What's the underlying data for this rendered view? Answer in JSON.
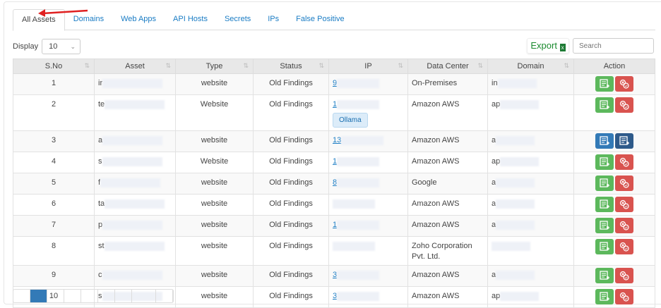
{
  "tabs": [
    "All Assets",
    "Domains",
    "Web Apps",
    "API Hosts",
    "Secrets",
    "IPs",
    "False Positive"
  ],
  "display_label": "Display",
  "display_value": "10",
  "export_label": "Export",
  "search_placeholder": "Search",
  "columns": [
    "S.No",
    "Asset",
    "Type",
    "Status",
    "IP",
    "Data Center",
    "Domain",
    "Action"
  ],
  "rows": [
    {
      "sno": "1",
      "asset": "ir",
      "type": "website",
      "status": "Old Findings",
      "ip": "9",
      "dc": "On-Premises",
      "domain": "in",
      "actions": "edit"
    },
    {
      "sno": "2",
      "asset": "te",
      "type": "Website",
      "status": "Old Findings",
      "ip": "1",
      "dc": "Amazon AWS",
      "domain": "ap",
      "badge": "Ollama",
      "actions": "edit"
    },
    {
      "sno": "3",
      "asset": "a",
      "type": "website",
      "status": "Old Findings",
      "ip": "13",
      "dc": "Amazon AWS",
      "domain": "a",
      "actions": "view"
    },
    {
      "sno": "4",
      "asset": "s",
      "type": "Website",
      "status": "Old Findings",
      "ip": "1",
      "dc": "Amazon AWS",
      "domain": "ap",
      "actions": "edit"
    },
    {
      "sno": "5",
      "asset": "f",
      "type": "website",
      "status": "Old Findings",
      "ip": "8",
      "dc": "Google",
      "domain": "a",
      "actions": "edit"
    },
    {
      "sno": "6",
      "asset": "ta",
      "type": "website",
      "status": "Old Findings",
      "ip": "",
      "dc": "Amazon AWS",
      "domain": "a",
      "actions": "edit"
    },
    {
      "sno": "7",
      "asset": "p",
      "type": "website",
      "status": "Old Findings",
      "ip": "1",
      "dc": "Amazon AWS",
      "domain": "a",
      "actions": "edit"
    },
    {
      "sno": "8",
      "asset": "st",
      "type": "website",
      "status": "Old Findings",
      "ip": "",
      "dc": "Zoho Corporation Pvt. Ltd.",
      "domain": "",
      "actions": "edit"
    },
    {
      "sno": "9",
      "asset": "c",
      "type": "website",
      "status": "Old Findings",
      "ip": "3",
      "dc": "Amazon AWS",
      "domain": "a",
      "actions": "edit"
    },
    {
      "sno": "10",
      "asset": "s",
      "type": "website",
      "status": "Old Findings",
      "ip": "3",
      "dc": "Amazon AWS",
      "domain": "ap",
      "actions": "edit"
    }
  ],
  "colors": {
    "link": "#1a7cc4",
    "green": "#5cb85c",
    "red": "#d9534f",
    "blue": "#337ab7"
  }
}
